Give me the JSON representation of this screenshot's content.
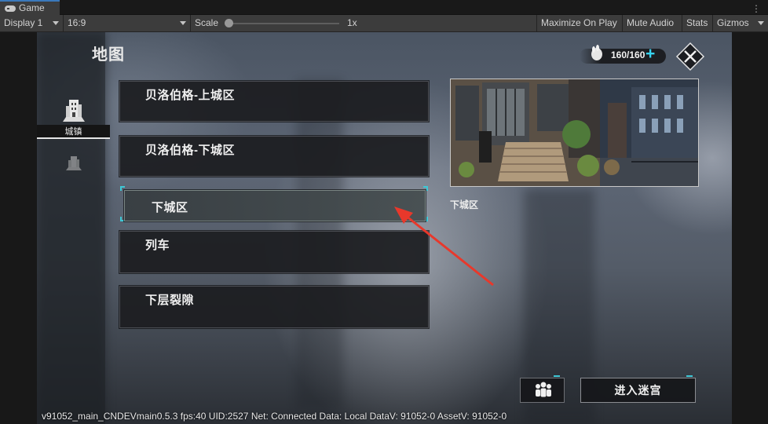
{
  "editor": {
    "tab_label": "Game",
    "tab_icon": "gamepad-icon",
    "tab_menu_glyph": "⋮",
    "display_label": "Display 1",
    "aspect_label": "16:9",
    "scale_label": "Scale",
    "scale_value": "1x",
    "scale_fraction": 0.0,
    "maximize_label": "Maximize On Play",
    "mute_label": "Mute Audio",
    "stats_label": "Stats",
    "gizmos_label": "Gizmos"
  },
  "game": {
    "page_title": "地图",
    "nav": [
      {
        "label": "城镇",
        "icon": "city-building-icon",
        "active": true
      },
      {
        "label": "",
        "icon": "dungeon-building-icon",
        "active": false
      }
    ],
    "locations": [
      {
        "label": "贝洛伯格-上城区",
        "selected": false
      },
      {
        "label": "贝洛伯格-下城区",
        "selected": false
      },
      {
        "label": "下城区",
        "selected": true
      },
      {
        "label": "列车",
        "selected": false
      },
      {
        "label": "下层裂隙",
        "selected": false
      }
    ],
    "preview_caption": "下城区",
    "stamina": {
      "value": "160/160",
      "plus": "+",
      "icon": "stamina-hand-icon",
      "color": "#37d3f0"
    },
    "close_icon": "close-x-icon",
    "group_icon": "team-people-icon",
    "enter_button": "进入迷宫",
    "accent_color": "#3fc8d6",
    "annotation_arrow_color": "#e8382b"
  },
  "debug_text": "v91052_main_CNDEVmain0.5.3  fps:40  UID:2527  Net: Connected  Data: Local  DataV: 91052-0  AssetV: 91052-0"
}
